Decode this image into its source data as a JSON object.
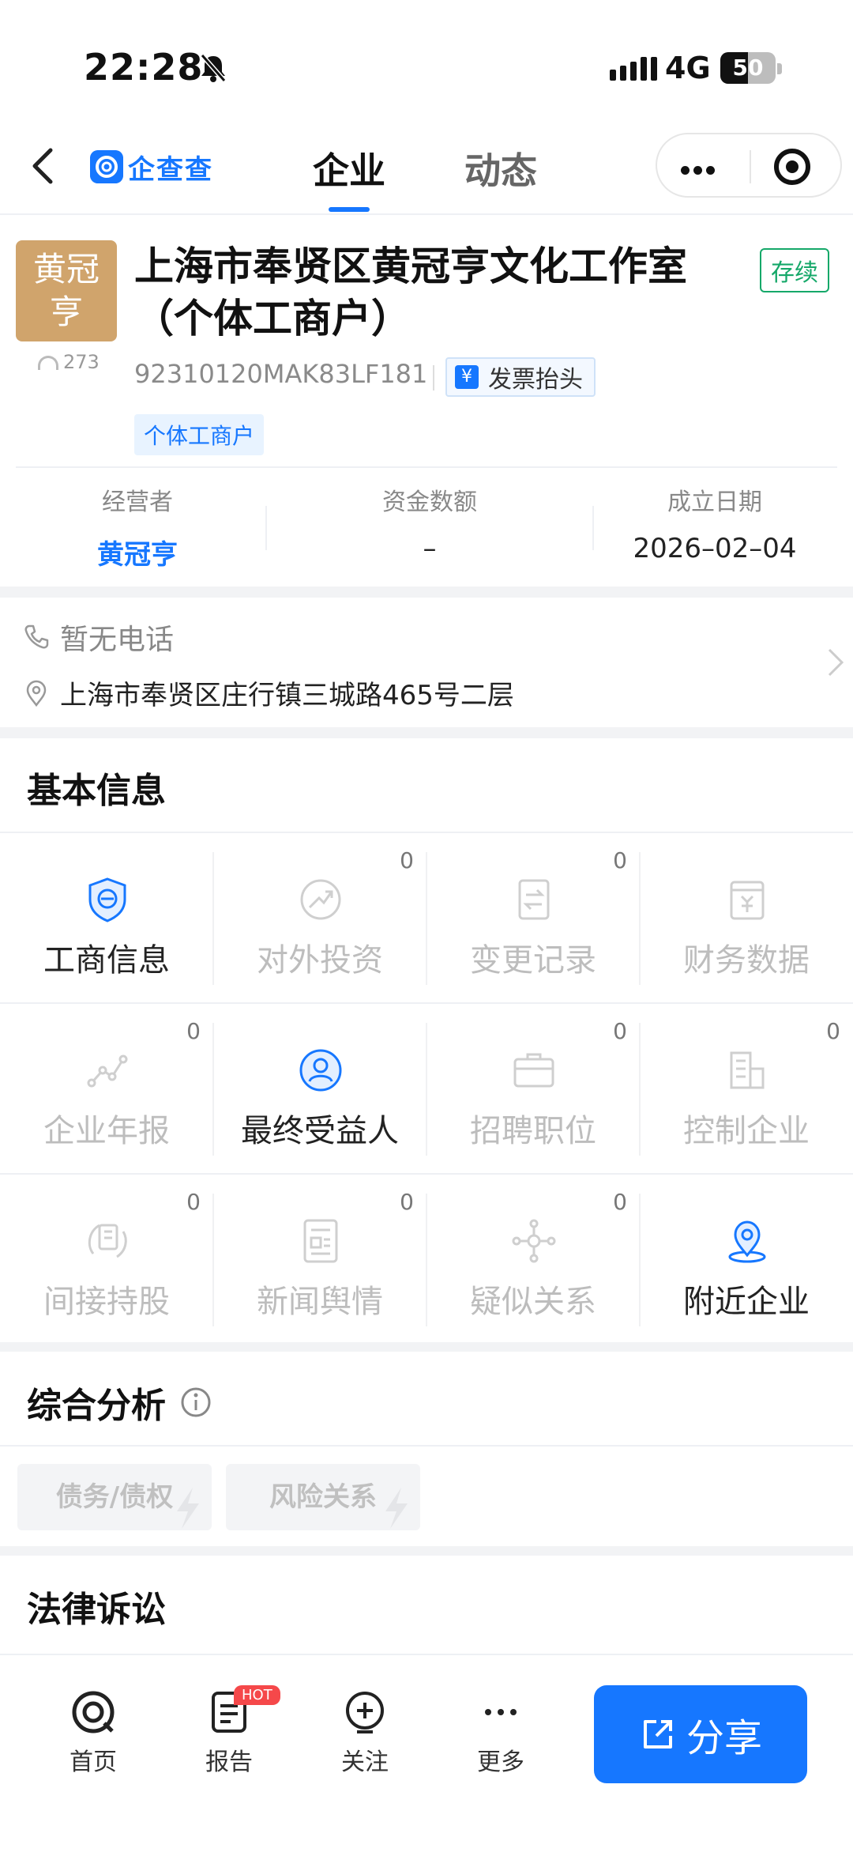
{
  "status_bar": {
    "time": "22:28",
    "network": "4G",
    "battery": "50",
    "battery_level": 0.5
  },
  "nav": {
    "logo_text": "企查查",
    "tabs": [
      "企业",
      "动态"
    ]
  },
  "company": {
    "avatar_text": [
      "黄冠",
      "亨"
    ],
    "views": "273",
    "name": "上海市奉贤区黄冠亨文化工作室（个体工商户）",
    "status": "存续",
    "credit_code": "92310120MAK83LF181",
    "invoice_label": "发票抬头",
    "invoice_icon": "¥",
    "type_tag": "个体工商户",
    "stats": [
      {
        "label": "经营者",
        "value": "黄冠亨"
      },
      {
        "label": "资金数额",
        "value": "–"
      },
      {
        "label": "成立日期",
        "value": "2026–02–04"
      }
    ]
  },
  "contact": {
    "phone": "暂无电话",
    "address": "上海市奉贤区庄行镇三城路465号二层"
  },
  "basic_info": {
    "title": "基本信息",
    "items": [
      {
        "label": "工商信息",
        "badge": "",
        "icon": "shield-icon",
        "active": true
      },
      {
        "label": "对外投资",
        "badge": "0",
        "icon": "investment-icon",
        "active": false
      },
      {
        "label": "变更记录",
        "badge": "0",
        "icon": "change-record-icon",
        "active": false
      },
      {
        "label": "财务数据",
        "badge": "",
        "icon": "finance-icon",
        "active": false
      },
      {
        "label": "企业年报",
        "badge": "0",
        "icon": "annual-report-icon",
        "active": false
      },
      {
        "label": "最终受益人",
        "badge": "",
        "icon": "beneficiary-icon",
        "active": true
      },
      {
        "label": "招聘职位",
        "badge": "0",
        "icon": "briefcase-icon",
        "active": false
      },
      {
        "label": "控制企业",
        "badge": "0",
        "icon": "building-icon",
        "active": false
      },
      {
        "label": "间接持股",
        "badge": "0",
        "icon": "indirect-holding-icon",
        "active": false
      },
      {
        "label": "新闻舆情",
        "badge": "0",
        "icon": "news-icon",
        "active": false
      },
      {
        "label": "疑似关系",
        "badge": "0",
        "icon": "relation-icon",
        "active": false
      },
      {
        "label": "附近企业",
        "badge": "",
        "icon": "location-icon",
        "active": true
      }
    ]
  },
  "analysis": {
    "title": "综合分析",
    "buttons": [
      "债务/债权",
      "风险关系"
    ]
  },
  "legal": {
    "title": "法律诉讼"
  },
  "bottom_bar": {
    "items": [
      {
        "label": "首页",
        "icon": "home-icon"
      },
      {
        "label": "报告",
        "icon": "report-icon",
        "badge": "HOT"
      },
      {
        "label": "关注",
        "icon": "follow-icon"
      },
      {
        "label": "更多",
        "icon": "more-icon"
      }
    ],
    "share_label": "分享"
  }
}
